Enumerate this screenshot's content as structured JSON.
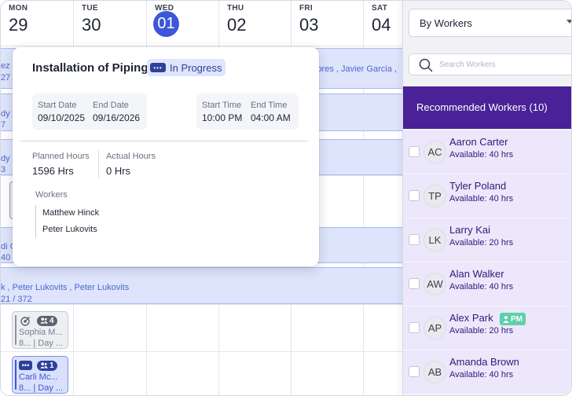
{
  "calendar": {
    "days": [
      {
        "dow": "MON",
        "num": "29",
        "today": false
      },
      {
        "dow": "TUE",
        "num": "30",
        "today": false
      },
      {
        "dow": "WED",
        "num": "01",
        "today": true
      },
      {
        "dow": "THU",
        "num": "02",
        "today": false
      },
      {
        "dow": "FRI",
        "num": "03",
        "today": false
      },
      {
        "dow": "SAT",
        "num": "04",
        "today": false
      }
    ],
    "bands": {
      "band1_left_a": "ez",
      "band1_left_b": "27",
      "band1_right": "lores , Javier Garcia ,",
      "band2_left_a": "dy",
      "band2_left_b": "7",
      "band3_left_a": "dy",
      "band3_left_b": "3",
      "band4_left_a": "di C",
      "band4_left_b": "40",
      "band5_text": "k , Peter Lukovits , Peter Lukovits",
      "band5_sub": "21 / 372"
    },
    "cards": [
      {
        "name": "Sophia M...",
        "line2": "8... | Day ...",
        "badge": "4",
        "icon": "target-icon"
      },
      {
        "name": "Carli Mc...",
        "line2": "8... | Day ...",
        "badge": "1",
        "icon": "dots-icon"
      }
    ]
  },
  "popover": {
    "title": "Installation of Piping",
    "status": "In Progress",
    "start_date_label": "Start Date",
    "start_date": "09/10/2025",
    "end_date_label": "End Date",
    "end_date": "09/16/2026",
    "start_time_label": "Start Time",
    "start_time": "10:00 PM",
    "end_time_label": "End Time",
    "end_time": "04:00 AM",
    "planned_label": "Planned Hours",
    "planned": "1596 Hrs",
    "actual_label": "Actual Hours",
    "actual": "0 Hrs",
    "workers_label": "Workers",
    "workers": [
      "Matthew Hinck",
      "Peter Lukovits"
    ]
  },
  "panel": {
    "group_by": "By Workers",
    "search_placeholder": "Search Workers",
    "recommended_title": "Recommended Workers (10)",
    "workers": [
      {
        "initials": "AC",
        "name": "Aaron Carter",
        "available": "Available: 40 hrs",
        "pm": false
      },
      {
        "initials": "TP",
        "name": "Tyler Poland",
        "available": "Available: 40 hrs",
        "pm": false
      },
      {
        "initials": "LK",
        "name": "Larry Kai",
        "available": "Available: 20 hrs",
        "pm": false
      },
      {
        "initials": "AW",
        "name": "Alan Walker",
        "available": "Available: 40 hrs",
        "pm": false
      },
      {
        "initials": "AP",
        "name": "Alex Park",
        "available": "Available: 20 hrs",
        "pm": true
      },
      {
        "initials": "AB",
        "name": "Amanda Brown",
        "available": "Available: 40 hrs",
        "pm": false
      }
    ],
    "pm_label": "PM"
  },
  "colors": {
    "accent": "#3e57d8",
    "header_purple": "#4a2196",
    "row_lavender": "#ece7fa",
    "pm_green": "#5fd0a9",
    "band_blue": "#dde4fb"
  }
}
